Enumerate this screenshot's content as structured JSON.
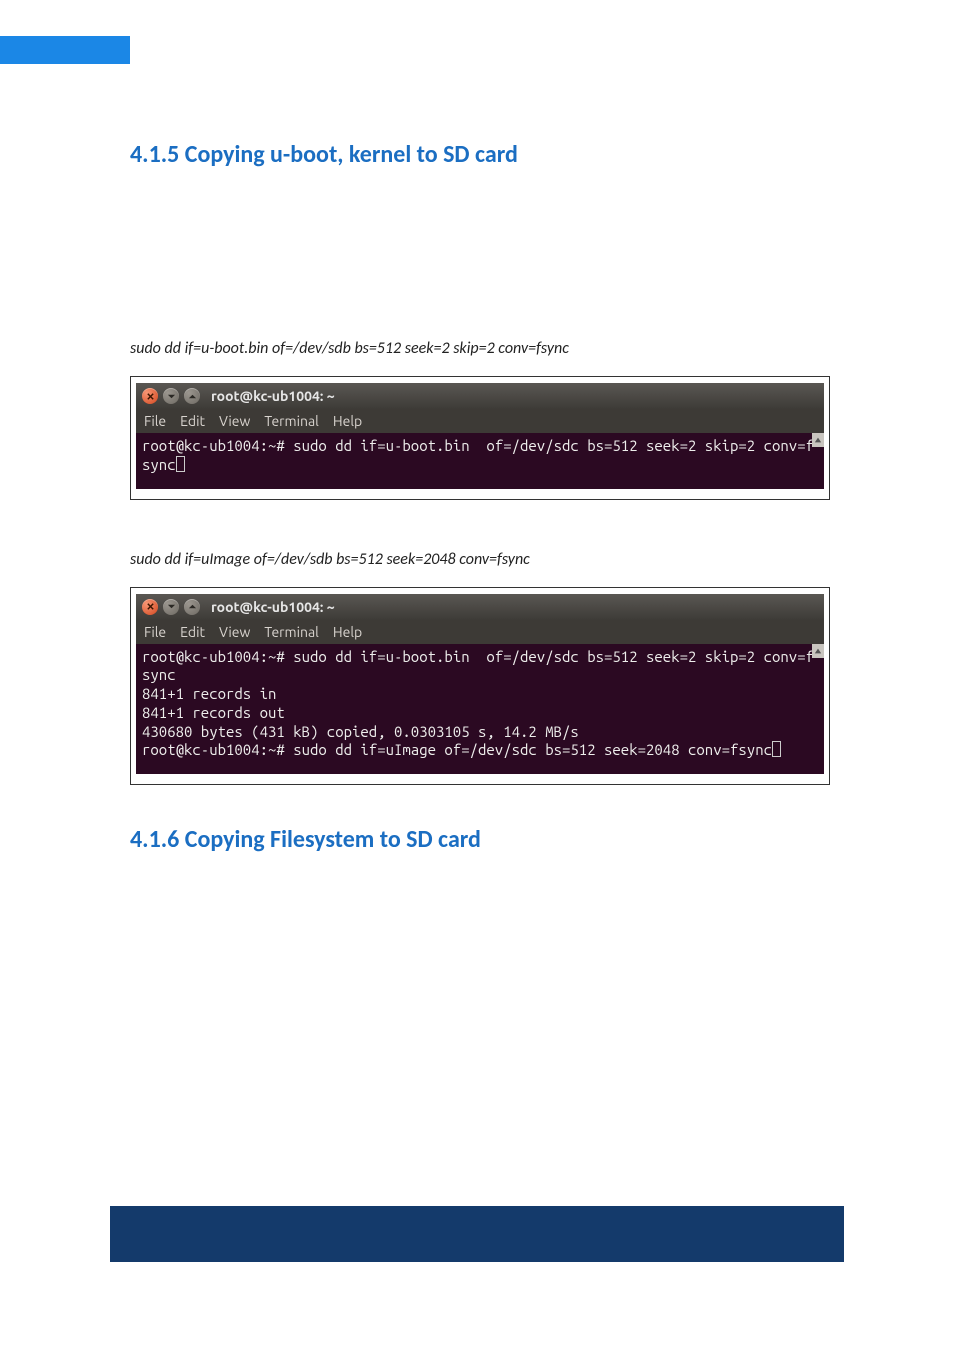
{
  "headings": {
    "h415": {
      "num": "4.1.5",
      "text": "Copying u-boot, kernel to SD card"
    },
    "h416": {
      "num": "4.1.6",
      "text": "Copying Filesystem to SD card"
    }
  },
  "commands": {
    "cmd1": "sudo dd if=u-boot.bin    of=/dev/sdb bs=512 seek=2 skip=2 conv=fsync",
    "cmd2": "sudo dd if=uImage of=/dev/sdb bs=512 seek=2048 conv=fsync"
  },
  "terminal": {
    "title": "root@kc-ub1004: ~",
    "menu": [
      "File",
      "Edit",
      "View",
      "Terminal",
      "Help"
    ],
    "body1": {
      "l1_prompt": "root@kc-ub1004:~# ",
      "l1_cmd": "sudo dd if=u-boot.bin  of=/dev/sdc bs=512 seek=2 skip=2 conv=f",
      "l2": "sync"
    },
    "body2": {
      "l1_prompt": "root@kc-ub1004:~# ",
      "l1_cmd": "sudo dd if=u-boot.bin  of=/dev/sdc bs=512 seek=2 skip=2 conv=f",
      "l2": "sync",
      "l3": "841+1 records in",
      "l4": "841+1 records out",
      "l5": "430680 bytes (431 kB) copied, 0.0303105 s, 14.2 MB/s",
      "l6_prompt": "root@kc-ub1004:~# ",
      "l6_cmd": "sudo dd if=uImage of=/dev/sdc bs=512 seek=2048 conv=fsync"
    }
  }
}
